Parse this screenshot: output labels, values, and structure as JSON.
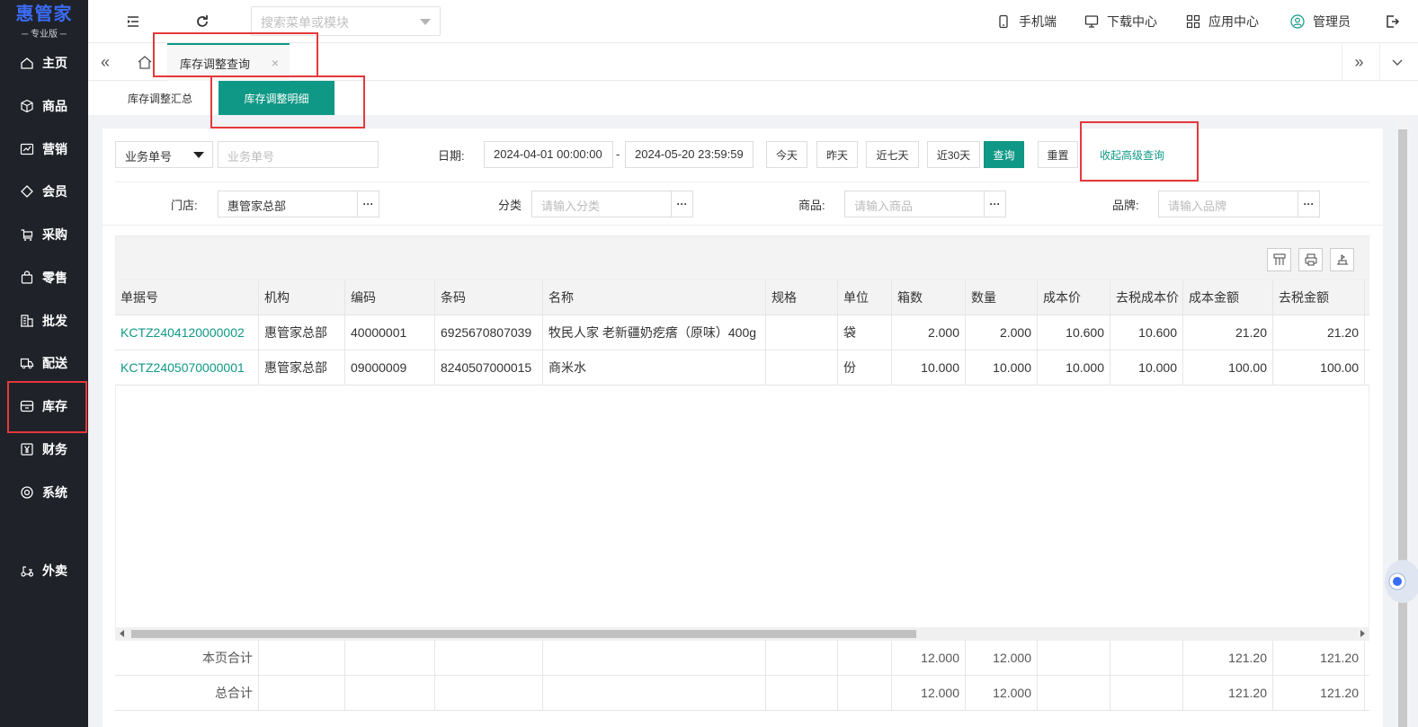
{
  "app": {
    "logo_main": "惠管家",
    "logo_sub": "─ 专业版 ─"
  },
  "sidebar": {
    "items": [
      {
        "label": "主页",
        "icon": "home-icon"
      },
      {
        "label": "商品",
        "icon": "cube-icon"
      },
      {
        "label": "营销",
        "icon": "chart-icon"
      },
      {
        "label": "会员",
        "icon": "diamond-icon"
      },
      {
        "label": "采购",
        "icon": "cart-icon"
      },
      {
        "label": "零售",
        "icon": "bag-icon"
      },
      {
        "label": "批发",
        "icon": "building-icon"
      },
      {
        "label": "配送",
        "icon": "truck-icon"
      },
      {
        "label": "库存",
        "icon": "box-icon"
      },
      {
        "label": "财务",
        "icon": "yen-icon"
      },
      {
        "label": "系统",
        "icon": "gear-icon"
      },
      {
        "label": "外卖",
        "icon": "scooter-icon"
      }
    ]
  },
  "topbar": {
    "search_placeholder": "搜索菜单或模块",
    "mobile": "手机端",
    "download": "下载中心",
    "apps": "应用中心",
    "user": "管理员"
  },
  "tabs": {
    "active_tab": "库存调整查询",
    "close": "×"
  },
  "subtabs": {
    "summary": "库存调整汇总",
    "detail": "库存调整明细"
  },
  "filters": {
    "field_select": "业务单号",
    "field_placeholder": "业务单号",
    "date_label": "日期:",
    "date_from": "2024-04-01 00:00:00",
    "date_sep": "-",
    "date_to": "2024-05-20 23:59:59",
    "today": "今天",
    "yesterday": "昨天",
    "last7": "近七天",
    "last30": "近30天",
    "query": "查询",
    "reset": "重置",
    "collapse": "收起高级查询",
    "store_label": "门店:",
    "store_value": "惠管家总部",
    "category_label": "分类",
    "category_placeholder": "请输入分类",
    "product_label": "商品:",
    "product_placeholder": "请输入商品",
    "brand_label": "品牌:",
    "brand_placeholder": "请输入品牌",
    "more": "···"
  },
  "table": {
    "columns": [
      "单据号",
      "机构",
      "编码",
      "条码",
      "名称",
      "规格",
      "单位",
      "箱数",
      "数量",
      "成本价",
      "去税成本价",
      "成本金额",
      "去税金额"
    ],
    "rows": [
      [
        "KCTZ2404120000002",
        "惠管家总部",
        "40000001",
        "6925670807039",
        "牧民人家 老新疆奶疙瘩（原味）400g",
        "",
        "袋",
        "2.000",
        "2.000",
        "10.600",
        "10.600",
        "21.20",
        "21.20"
      ],
      [
        "KCTZ2405070000001",
        "惠管家总部",
        "09000009",
        "8240507000015",
        "商米水",
        "",
        "份",
        "10.000",
        "10.000",
        "10.000",
        "10.000",
        "100.00",
        "100.00"
      ]
    ],
    "page_total": {
      "label": "本页合计",
      "boxes": "12.000",
      "qty": "12.000",
      "cost_amount": "121.20",
      "net_amount": "121.20"
    },
    "grand_total": {
      "label": "总合计",
      "boxes": "12.000",
      "qty": "12.000",
      "cost_amount": "121.20",
      "net_amount": "121.20"
    }
  },
  "colors": {
    "accent": "#0f9885",
    "sidebar_bg": "#1f2229",
    "highlight": "#e5383b",
    "logo": "#3b6cf6"
  }
}
